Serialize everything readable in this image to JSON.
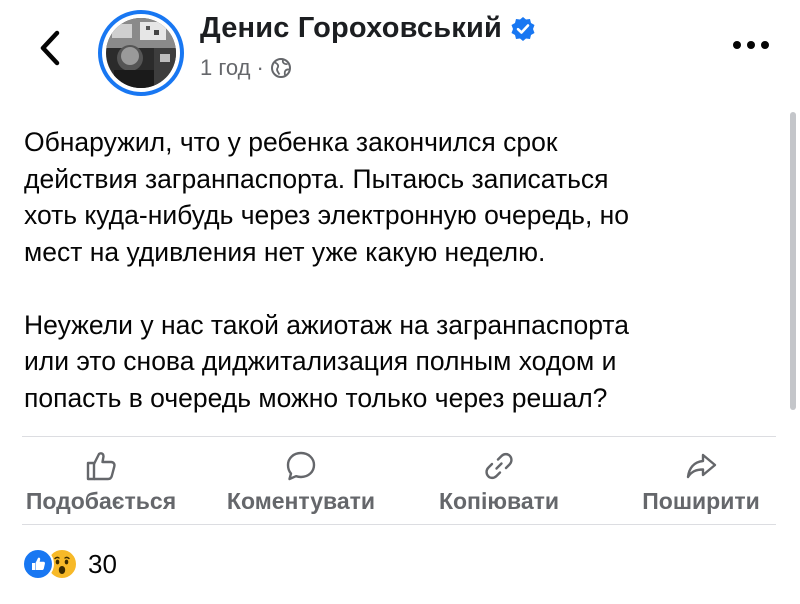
{
  "header": {
    "author_name": "Денис Гороховський",
    "time_ago": "1 год",
    "separator": "·"
  },
  "post": {
    "text": "Обнаружил, что у ребенка закончился срок\nдействия загранпаспорта. Пытаюсь записаться\nхоть куда-нибудь через электронную очередь, но\nмест на удивления нет уже какую неделю.\n\nНеужели у нас такой ажиотаж на загранпаспорта\nили это снова диджитализация полным ходом и\nпопасть в очередь можно только через решал?"
  },
  "actions": {
    "like": "Подобається",
    "comment": "Коментувати",
    "copy": "Копіювати",
    "share": "Поширити"
  },
  "reactions": {
    "count": "30"
  },
  "colors": {
    "accent": "#1877f2",
    "secondary_text": "#65676b",
    "wow": "#f7b928"
  },
  "icons": [
    "back-arrow-icon",
    "verified-badge-icon",
    "globe-icon",
    "more-dots-icon",
    "like-icon",
    "comment-icon",
    "link-icon",
    "share-icon",
    "like-reaction-icon",
    "wow-reaction-icon"
  ]
}
